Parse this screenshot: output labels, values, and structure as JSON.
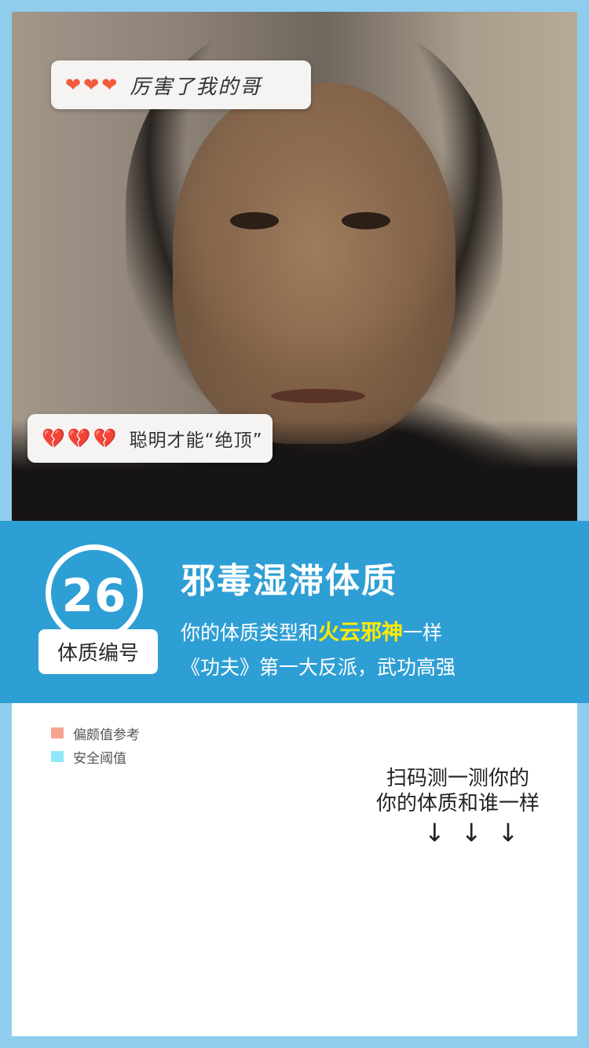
{
  "comments": [
    {
      "hearts": [
        "❤",
        "❤",
        "❤"
      ],
      "text": "厉害了我的哥"
    },
    {
      "hearts": [
        "💔",
        "💔",
        "💔"
      ],
      "text": "聪明才能“绝顶”"
    }
  ],
  "badge": {
    "number": "26",
    "label": "体质编号"
  },
  "result": {
    "title": "邪毒湿滞体质",
    "line1_prefix": "你的体质类型和",
    "line1_highlight": "火云邪神",
    "line1_suffix": "一样",
    "line2": "《功夫》第一大反派，武功高强"
  },
  "legend": [
    {
      "label": "偏颇值参考",
      "color": "#f7a392"
    },
    {
      "label": "安全阈值",
      "color": "#8fe8f7"
    }
  ],
  "cta": {
    "line1": "扫码测一测你的",
    "line2": "你的体质和谁一样",
    "arrows": [
      "↓",
      "↓",
      "↓"
    ]
  },
  "colors": {
    "band": "#2e9fd4",
    "highlight": "#ffea00",
    "frame": "#8fcdef",
    "heart": "#f25a3a"
  }
}
